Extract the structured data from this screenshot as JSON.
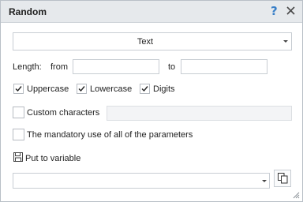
{
  "window": {
    "title": "Random",
    "help_glyph": "?"
  },
  "type_select": {
    "value": "Text"
  },
  "length": {
    "label": "Length:",
    "from_label": "from",
    "to_label": "to",
    "from_value": "",
    "to_value": ""
  },
  "checkboxes": {
    "uppercase": {
      "label": "Uppercase",
      "checked": true
    },
    "lowercase": {
      "label": "Lowercase",
      "checked": true
    },
    "digits": {
      "label": "Digits",
      "checked": true
    },
    "custom": {
      "label": "Custom characters",
      "checked": false,
      "value": ""
    },
    "mandatory": {
      "label": "The mandatory use of all of the parameters",
      "checked": false
    }
  },
  "output": {
    "label": "Put to variable",
    "variable_value": ""
  },
  "icons": [
    "help-icon",
    "close-icon",
    "dropdown-arrow-icon",
    "checkmark-icon",
    "save-icon",
    "copy-icon",
    "resize-grip-icon"
  ],
  "colors": {
    "titlebar": "#e6e9ec",
    "help": "#3a80c8",
    "border": "#c8cdd3"
  }
}
